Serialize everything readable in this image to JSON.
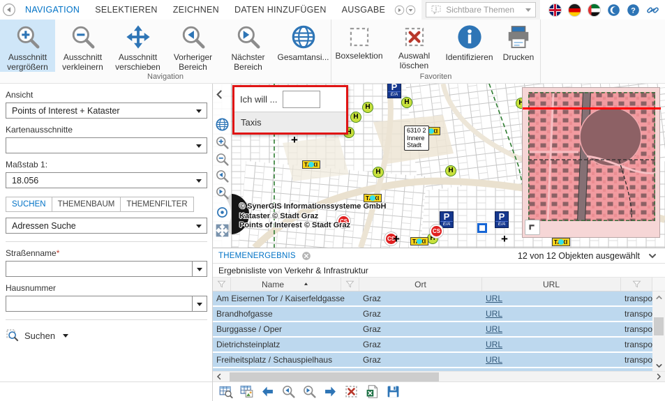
{
  "menubar": {
    "tabs": [
      {
        "label": "NAVIGATION",
        "active": true
      },
      {
        "label": "SELEKTIEREN",
        "active": false
      },
      {
        "label": "ZEICHNEN",
        "active": false
      },
      {
        "label": "DATEN HINZUFÜGEN",
        "active": false
      },
      {
        "label": "AUSGABE",
        "active": false
      }
    ],
    "visible_themes_placeholder": "Sichtbare Themen"
  },
  "ribbon": {
    "groups": [
      {
        "label": "Navigation",
        "buttons": [
          {
            "label1": "Ausschnitt",
            "label2": "vergrößern"
          },
          {
            "label1": "Ausschnitt",
            "label2": "verkleinern"
          },
          {
            "label1": "Ausschnitt",
            "label2": "verschieben"
          },
          {
            "label1": "Vorheriger",
            "label2": "Bereich"
          },
          {
            "label1": "Nächster",
            "label2": "Bereich"
          },
          {
            "label1": "Gesamtansi...",
            "label2": ""
          }
        ]
      },
      {
        "label": "Favoriten",
        "buttons": [
          {
            "label1": "Boxselektion",
            "label2": ""
          },
          {
            "label1": "Auswahl",
            "label2": "löschen"
          },
          {
            "label1": "Identifizieren",
            "label2": ""
          },
          {
            "label1": "Drucken",
            "label2": ""
          }
        ]
      }
    ]
  },
  "sidebar": {
    "ansicht_label": "Ansicht",
    "ansicht_value": "Points of Interest + Kataster",
    "kartenausschnitte_label": "Kartenausschnitte",
    "kartenausschnitte_value": "",
    "massstab_label": "Maßstab 1:",
    "massstab_value": "18.056",
    "tabs": [
      {
        "label": "SUCHEN",
        "active": true
      },
      {
        "label": "THEMENBAUM",
        "active": false
      },
      {
        "label": "THEMENFILTER",
        "active": false
      }
    ],
    "search_type_value": "Adressen Suche",
    "strassenname_label": "Straßenname",
    "required_mark": "*",
    "hausnummer_label": "Hausnummer",
    "suchen_button_label": "Suchen"
  },
  "map": {
    "popup": {
      "prompt": "Ich will ...",
      "input_value": "",
      "item": "Taxis"
    },
    "district": {
      "code": "6310 2",
      "line1": "Innere",
      "line2": "Stadt"
    },
    "copyright": {
      "line1": "© SynerGIS Informationssysteme GmbH",
      "line2": "Kataster © Stadt Graz",
      "line3": "Points of Interest © Stadt Graz"
    },
    "markers": {
      "h": "H",
      "taxi": "TAXI",
      "p": "P",
      "p_sub": "E/A",
      "cs": "CS",
      "plus": "+"
    }
  },
  "results": {
    "tab_label": "THEMENERGEBNIS",
    "selection_status": "12 von 12 Objekten ausgewählt",
    "subtitle": "Ergebnisliste von Verkehr & Infrastruktur",
    "columns": {
      "name": "Name",
      "ort": "Ort",
      "url": "URL"
    },
    "rows": [
      {
        "name": "Am Eisernen Tor / Kaiserfeldgasse",
        "ort": "Graz",
        "url": "URL",
        "extra": "transport"
      },
      {
        "name": "Brandhofgasse",
        "ort": "Graz",
        "url": "URL",
        "extra": "transport"
      },
      {
        "name": "Burggasse / Oper",
        "ort": "Graz",
        "url": "URL",
        "extra": "transport"
      },
      {
        "name": "Dietrichsteinplatz",
        "ort": "Graz",
        "url": "URL",
        "extra": "transport"
      },
      {
        "name": "Freiheitsplatz / Schauspielhaus",
        "ort": "Graz",
        "url": "URL",
        "extra": "transport"
      }
    ]
  },
  "colors": {
    "accent": "#0072c6",
    "selected_row": "#bdd8ee",
    "ribbon_highlight": "#cfe6f8",
    "popup_border": "#e01414",
    "taxi_yellow": "#f8d41b",
    "stop_green": "#c9e13c",
    "overview_pink": "#f29ba0",
    "link": "#33597a"
  }
}
